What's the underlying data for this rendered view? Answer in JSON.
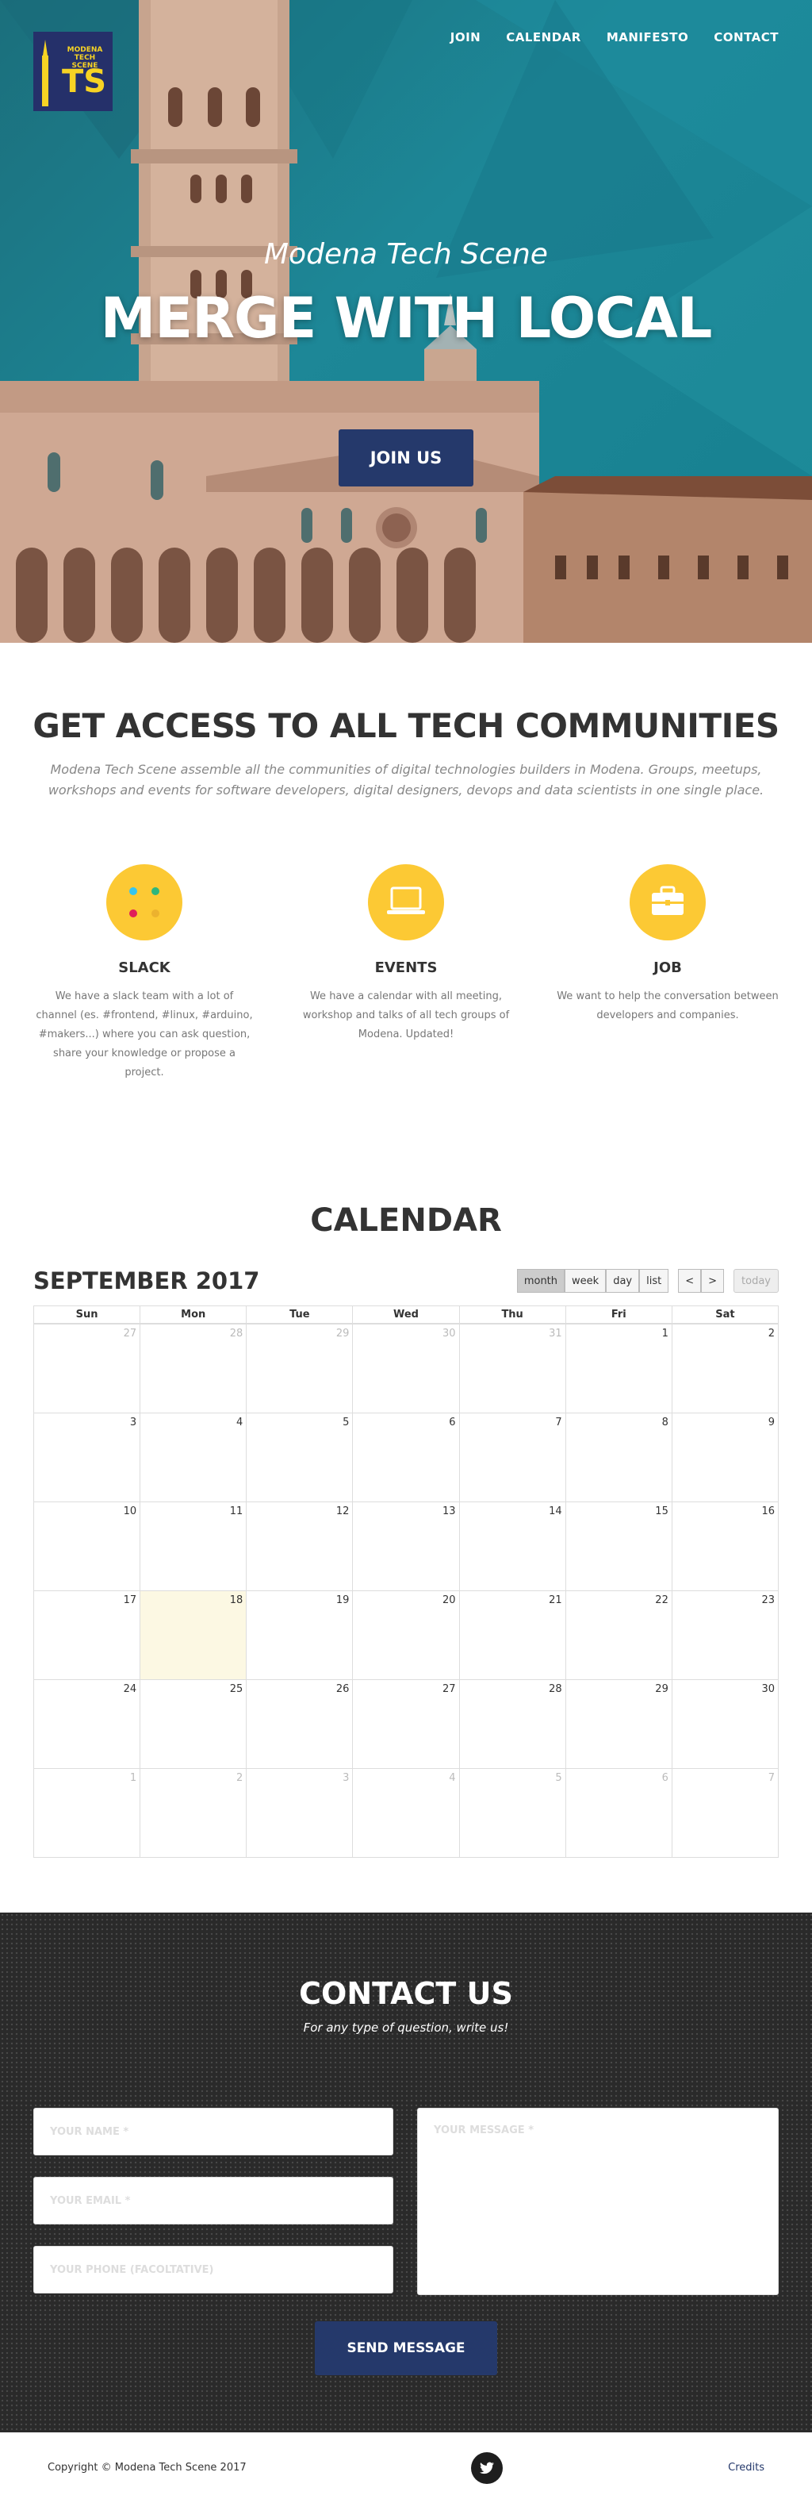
{
  "nav": {
    "join": "JOIN",
    "calendar": "CALENDAR",
    "manifesto": "MANIFESTO",
    "contact": "CONTACT"
  },
  "logo": {
    "line1": "MODENA",
    "line2": "TECH SCENE",
    "mark": "TS"
  },
  "hero": {
    "subtitle": "Modena Tech Scene",
    "title": "MERGE WITH LOCAL",
    "cta": "JOIN US"
  },
  "access": {
    "title": "GET ACCESS TO ALL TECH COMMUNITIES",
    "lead": "Modena Tech Scene assemble all the communities of digital technologies builders in Modena. Groups, meetups, workshops and events for software developers, digital designers, devops and data scientists in one single place.",
    "features": [
      {
        "icon": "slack-icon",
        "title": "SLACK",
        "text": "We have a slack team with a lot of channel (es. #frontend, #linux, #arduino, #makers...) where you can ask question, share your knowledge or propose a project."
      },
      {
        "icon": "laptop-icon",
        "title": "EVENTS",
        "text": "We have a calendar with all meeting, workshop and talks of all tech groups of Modena. Updated!"
      },
      {
        "icon": "briefcase-icon",
        "title": "JOB",
        "text": "We want to help the conversation between developers and companies."
      }
    ]
  },
  "calendar": {
    "title": "CALENDAR",
    "month": "SEPTEMBER 2017",
    "views": [
      "month",
      "week",
      "day",
      "list"
    ],
    "active_view": "month",
    "prev": "<",
    "next": ">",
    "today": "today",
    "weekdays": [
      "Sun",
      "Mon",
      "Tue",
      "Wed",
      "Thu",
      "Fri",
      "Sat"
    ],
    "weeks": [
      [
        [
          "27",
          0
        ],
        [
          "28",
          0
        ],
        [
          "29",
          0
        ],
        [
          "30",
          0
        ],
        [
          "31",
          0
        ],
        [
          "1",
          1
        ],
        [
          "2",
          1
        ]
      ],
      [
        [
          "3",
          1
        ],
        [
          "4",
          1
        ],
        [
          "5",
          1
        ],
        [
          "6",
          1
        ],
        [
          "7",
          1
        ],
        [
          "8",
          1
        ],
        [
          "9",
          1
        ]
      ],
      [
        [
          "10",
          1
        ],
        [
          "11",
          1
        ],
        [
          "12",
          1
        ],
        [
          "13",
          1
        ],
        [
          "14",
          1
        ],
        [
          "15",
          1
        ],
        [
          "16",
          1
        ]
      ],
      [
        [
          "17",
          1
        ],
        [
          "18",
          2
        ],
        [
          "19",
          1
        ],
        [
          "20",
          1
        ],
        [
          "21",
          1
        ],
        [
          "22",
          1
        ],
        [
          "23",
          1
        ]
      ],
      [
        [
          "24",
          1
        ],
        [
          "25",
          1
        ],
        [
          "26",
          1
        ],
        [
          "27",
          1
        ],
        [
          "28",
          1
        ],
        [
          "29",
          1
        ],
        [
          "30",
          1
        ]
      ],
      [
        [
          "1",
          0
        ],
        [
          "2",
          0
        ],
        [
          "3",
          0
        ],
        [
          "4",
          0
        ],
        [
          "5",
          0
        ],
        [
          "6",
          0
        ],
        [
          "7",
          0
        ]
      ]
    ]
  },
  "contact": {
    "title": "CONTACT US",
    "tagline": "For any type of question, write us!",
    "name_placeholder": "YOUR NAME *",
    "email_placeholder": "YOUR EMAIL *",
    "phone_placeholder": "YOUR PHONE (FACOLTATIVE)",
    "message_placeholder": "YOUR MESSAGE *",
    "send": "SEND MESSAGE"
  },
  "footer": {
    "copyright": "Copyright © Modena Tech Scene 2017",
    "credits": "Credits"
  },
  "colors": {
    "navy": "#25396b",
    "yellow": "#fcc934",
    "teal": "#1d8797"
  }
}
